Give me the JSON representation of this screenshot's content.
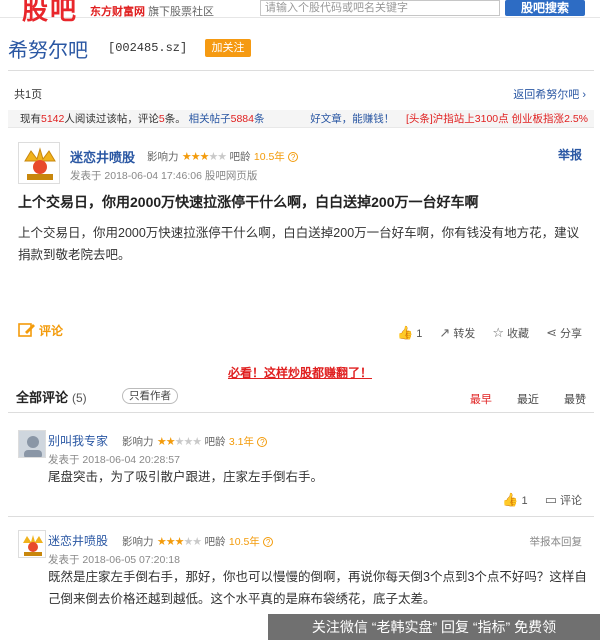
{
  "header": {
    "logo": "股吧",
    "site_brand": "东方财富网",
    "site_suffix": "旗下股票社区",
    "search_placeholder": "请输入个股代码或吧名关键字",
    "search_button": "股吧搜索"
  },
  "bar": {
    "name": "希努尔吧",
    "code": "[002485.sz]",
    "follow": "加关注"
  },
  "pagination": {
    "pages": "共1页",
    "back": "返回希努尔吧"
  },
  "stats": {
    "prefix": "现有",
    "readers": "5142",
    "readers_suffix": "人阅读过该帖，评论",
    "comments": "5",
    "comments_suffix": "条。",
    "related_label": "相关帖子",
    "related_count": "5884",
    "related_suffix": "条",
    "promo1": "好文章，能赚钱！",
    "promo2_prefix": "[头条]沪指站上3100点 创业板指涨",
    "promo2_value": "2.5%"
  },
  "post": {
    "user": "迷恋井喷股",
    "influence_label": "影响力",
    "stars_on": "★★★",
    "stars_off": "★★",
    "age_label": "吧龄",
    "age": "10.5年",
    "time": "发表于 2018-06-04 17:46:06 股吧网页版",
    "report": "举报",
    "title": "上个交易日，你用2000万快速拉涨停干什么啊，白白送掉200万一台好车啊",
    "body": "上个交易日，你用2000万快速拉涨停干什么啊，白白送掉200万一台好车啊，你有钱没有地方花，建议捐款到敬老院去吧。",
    "comment_label": "评论",
    "like_count": "1",
    "repost": "转发",
    "collect": "收藏",
    "share": "分享"
  },
  "promo_link": "必看！这样炒股都赚翻了！",
  "comments_section": {
    "title": "全部评论",
    "count": "(5)",
    "author_only": "只看作者",
    "sort_hot": "最早",
    "sort_latest": "最近",
    "sort_top": "最赞"
  },
  "comments": [
    {
      "user": "别叫我专家",
      "influence_label": "影响力",
      "stars_on": "★★",
      "stars_off": "★★★",
      "age_label": "吧龄",
      "age": "3.1年",
      "time": "发表于 2018-06-04 20:28:57",
      "text": "尾盘突击，为了吸引散户跟进，庄家左手倒右手。",
      "like_count": "1",
      "reply": "评论"
    },
    {
      "user": "迷恋井喷股",
      "influence_label": "影响力",
      "stars_on": "★★★",
      "stars_off": "★★",
      "age_label": "吧龄",
      "age": "10.5年",
      "time": "发表于 2018-06-05 07:20:18",
      "text_line1": "既然是庄家左手倒右手，那好，你也可以慢慢的倒啊，再说你每天倒3个点到3个点不好吗？这样自",
      "text_line2": "己倒来倒去价格还越到越低。这个水平真的是麻布袋绣花，底子太差。",
      "actions": "举报本回复"
    }
  ],
  "watermark": "关注微信 “老韩实盘” 回复 “指标” 免费领"
}
